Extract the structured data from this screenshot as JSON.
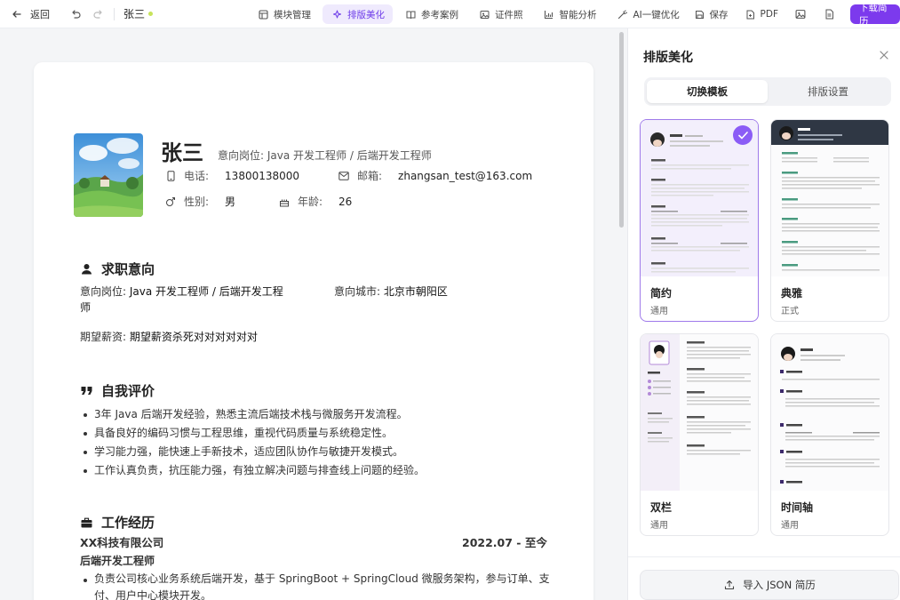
{
  "topbar": {
    "back_label": "返回",
    "doc_name": "张三",
    "nav": [
      {
        "label": "模块管理",
        "icon": "layout-icon"
      },
      {
        "label": "排版美化",
        "icon": "sparkle-icon",
        "active": true
      },
      {
        "label": "参考案例",
        "icon": "book-icon"
      },
      {
        "label": "证件照",
        "icon": "image-icon"
      },
      {
        "label": "智能分析",
        "icon": "bar-chart-icon"
      },
      {
        "label": "AI一键优化",
        "icon": "wand-icon"
      }
    ],
    "save_label": "保存",
    "pdf_label": "PDF",
    "download_label": "下载简历",
    "accent_color": "#7c3aed"
  },
  "resume": {
    "name": "张三",
    "intent_line": "意向岗位: Java 开发工程师 / 后端开发工程师",
    "phone_label": "电话:",
    "phone": "13800138000",
    "email_label": "邮箱:",
    "email": "zhangsan_test@163.com",
    "gender_label": "性别:",
    "gender": "男",
    "age_label": "年龄:",
    "age": "26",
    "sections": {
      "intent": {
        "title": "求职意向",
        "position_label": "意向岗位:",
        "position_line1": "Java 开发工程师 / 后端开发工程",
        "position_line2": "师",
        "city_label": "意向城市:",
        "city": "北京市朝阳区",
        "salary_label": "期望薪资:",
        "salary": "期望薪资杀死对对对对对对"
      },
      "self": {
        "title": "自我评价",
        "items": [
          "3年 Java 后端开发经验，熟悉主流后端技术栈与微服务开发流程。",
          "具备良好的编码习惯与工程思维，重视代码质量与系统稳定性。",
          "学习能力强，能快速上手新技术，适应团队协作与敏捷开发模式。",
          "工作认真负责，抗压能力强，有独立解决问题与排查线上问题的经验。"
        ]
      },
      "work": {
        "title": "工作经历",
        "company": "XX科技有限公司",
        "period": "2022.07 - 至今",
        "role": "后端开发工程师",
        "item_line1": "负责公司核心业务系统后端开发，基于 SpringBoot + SpringCloud 微服务架构，参与订单、支",
        "item_line2": "付、用户中心模块开发。"
      }
    }
  },
  "panel": {
    "title": "排版美化",
    "tabs": [
      {
        "label": "切换模板",
        "active": true
      },
      {
        "label": "排版设置",
        "active": false
      }
    ],
    "templates": [
      {
        "name": "简约",
        "sub": "通用",
        "selected": true
      },
      {
        "name": "典雅",
        "sub": "正式",
        "selected": false
      },
      {
        "name": "双栏",
        "sub": "通用",
        "selected": false
      },
      {
        "name": "时间轴",
        "sub": "通用",
        "selected": false
      }
    ],
    "import_label": "导入 JSON 简历"
  }
}
